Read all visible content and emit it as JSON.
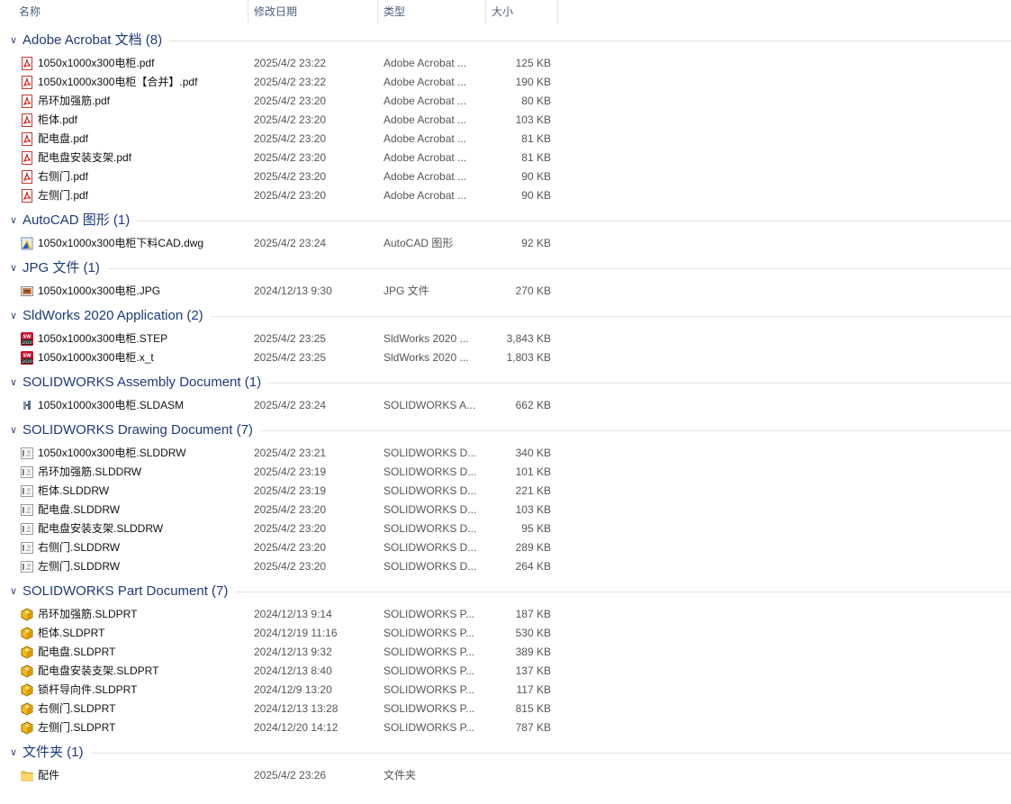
{
  "columns": {
    "name": "名称",
    "date": "修改日期",
    "type": "类型",
    "size": "大小"
  },
  "groups": [
    {
      "title": "Adobe Acrobat 文档 (8)",
      "icon": "pdf-icon",
      "items": [
        {
          "name": "1050x1000x300电柜.pdf",
          "date": "2025/4/2 23:22",
          "type": "Adobe Acrobat ...",
          "size": "125 KB"
        },
        {
          "name": "1050x1000x300电柜【合并】.pdf",
          "date": "2025/4/2 23:22",
          "type": "Adobe Acrobat ...",
          "size": "190 KB"
        },
        {
          "name": "吊环加强筋.pdf",
          "date": "2025/4/2 23:20",
          "type": "Adobe Acrobat ...",
          "size": "80 KB"
        },
        {
          "name": "柜体.pdf",
          "date": "2025/4/2 23:20",
          "type": "Adobe Acrobat ...",
          "size": "103 KB"
        },
        {
          "name": "配电盘.pdf",
          "date": "2025/4/2 23:20",
          "type": "Adobe Acrobat ...",
          "size": "81 KB"
        },
        {
          "name": "配电盘安装支架.pdf",
          "date": "2025/4/2 23:20",
          "type": "Adobe Acrobat ...",
          "size": "81 KB"
        },
        {
          "name": "右侧门.pdf",
          "date": "2025/4/2 23:20",
          "type": "Adobe Acrobat ...",
          "size": "90 KB"
        },
        {
          "name": "左侧门.pdf",
          "date": "2025/4/2 23:20",
          "type": "Adobe Acrobat ...",
          "size": "90 KB"
        }
      ]
    },
    {
      "title": "AutoCAD 图形 (1)",
      "icon": "dwg-icon",
      "items": [
        {
          "name": "1050x1000x300电柜下料CAD.dwg",
          "date": "2025/4/2 23:24",
          "type": "AutoCAD 图形",
          "size": "92 KB"
        }
      ]
    },
    {
      "title": "JPG 文件 (1)",
      "icon": "jpg-icon",
      "items": [
        {
          "name": "1050x1000x300电柜.JPG",
          "date": "2024/12/13 9:30",
          "type": "JPG 文件",
          "size": "270 KB"
        }
      ]
    },
    {
      "title": "SldWorks 2020 Application (2)",
      "icon": "sldworks-2020-icon",
      "items": [
        {
          "name": "1050x1000x300电柜.STEP",
          "date": "2025/4/2 23:25",
          "type": "SldWorks 2020 ...",
          "size": "3,843 KB"
        },
        {
          "name": "1050x1000x300电柜.x_t",
          "date": "2025/4/2 23:25",
          "type": "SldWorks 2020 ...",
          "size": "1,803 KB"
        }
      ]
    },
    {
      "title": "SOLIDWORKS Assembly Document (1)",
      "icon": "assembly-icon",
      "items": [
        {
          "name": "1050x1000x300电柜.SLDASM",
          "date": "2025/4/2 23:24",
          "type": "SOLIDWORKS A...",
          "size": "662 KB"
        }
      ]
    },
    {
      "title": "SOLIDWORKS Drawing Document (7)",
      "icon": "drawing-icon",
      "items": [
        {
          "name": "1050x1000x300电柜.SLDDRW",
          "date": "2025/4/2 23:21",
          "type": "SOLIDWORKS D...",
          "size": "340 KB"
        },
        {
          "name": "吊环加强筋.SLDDRW",
          "date": "2025/4/2 23:19",
          "type": "SOLIDWORKS D...",
          "size": "101 KB"
        },
        {
          "name": "柜体.SLDDRW",
          "date": "2025/4/2 23:19",
          "type": "SOLIDWORKS D...",
          "size": "221 KB"
        },
        {
          "name": "配电盘.SLDDRW",
          "date": "2025/4/2 23:20",
          "type": "SOLIDWORKS D...",
          "size": "103 KB"
        },
        {
          "name": "配电盘安装支架.SLDDRW",
          "date": "2025/4/2 23:20",
          "type": "SOLIDWORKS D...",
          "size": "95 KB"
        },
        {
          "name": "右侧门.SLDDRW",
          "date": "2025/4/2 23:20",
          "type": "SOLIDWORKS D...",
          "size": "289 KB"
        },
        {
          "name": "左侧门.SLDDRW",
          "date": "2025/4/2 23:20",
          "type": "SOLIDWORKS D...",
          "size": "264 KB"
        }
      ]
    },
    {
      "title": "SOLIDWORKS Part Document (7)",
      "icon": "part-icon",
      "items": [
        {
          "name": "吊环加强筋.SLDPRT",
          "date": "2024/12/13 9:14",
          "type": "SOLIDWORKS P...",
          "size": "187 KB"
        },
        {
          "name": "柜体.SLDPRT",
          "date": "2024/12/19 11:16",
          "type": "SOLIDWORKS P...",
          "size": "530 KB"
        },
        {
          "name": "配电盘.SLDPRT",
          "date": "2024/12/13 9:32",
          "type": "SOLIDWORKS P...",
          "size": "389 KB"
        },
        {
          "name": "配电盘安装支架.SLDPRT",
          "date": "2024/12/13 8:40",
          "type": "SOLIDWORKS P...",
          "size": "137 KB"
        },
        {
          "name": "锁杆导向件.SLDPRT",
          "date": "2024/12/9 13:20",
          "type": "SOLIDWORKS P...",
          "size": "117 KB"
        },
        {
          "name": "右侧门.SLDPRT",
          "date": "2024/12/13 13:28",
          "type": "SOLIDWORKS P...",
          "size": "815 KB"
        },
        {
          "name": "左侧门.SLDPRT",
          "date": "2024/12/20 14:12",
          "type": "SOLIDWORKS P...",
          "size": "787 KB"
        }
      ]
    },
    {
      "title": "文件夹 (1)",
      "icon": "folder-icon",
      "items": [
        {
          "name": "配件",
          "date": "2025/4/2 23:26",
          "type": "文件夹",
          "size": ""
        }
      ]
    }
  ]
}
